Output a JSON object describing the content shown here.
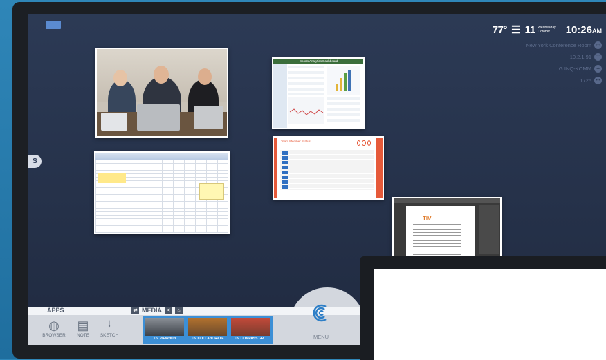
{
  "status": {
    "temperature": "77°",
    "weather_icon": "wind-icon",
    "day_number": "11",
    "weekday": "Wednesday",
    "month": "October",
    "time": "10:26",
    "ampm": "AM",
    "info": [
      {
        "text": "New York Conference Room",
        "icon": "monitor-icon",
        "glyph": "▭"
      },
      {
        "text": "10.2.1.91",
        "icon": "wifi-icon",
        "glyph": "⌔"
      },
      {
        "text": "G.INQ-KOMM",
        "icon": "network-icon",
        "glyph": "⏶"
      },
      {
        "text": "1725",
        "icon": "more-icon",
        "glyph": "•••"
      }
    ]
  },
  "windows": {
    "dashboard_title": "Sports Analytics Dashboard",
    "form_title": "Team Member Status"
  },
  "side_badge": "S",
  "dock": {
    "apps_title": "APPS",
    "media_title": "MEDIA",
    "apps": [
      {
        "label": "BROWSER",
        "icon": "globe-icon",
        "glyph": "🌐"
      },
      {
        "label": "NOTE",
        "icon": "note-icon",
        "glyph": "▤"
      },
      {
        "label": "SKETCH",
        "icon": "waveform-icon",
        "glyph": "⋀⋁"
      }
    ],
    "media": [
      {
        "label": "TIV VIEWHUB"
      },
      {
        "label": "TIV COLLABORATE"
      },
      {
        "label": "TIV COMPASS GR..."
      }
    ],
    "menu_label": "MENU"
  },
  "colors": {
    "accent": "#3c8fd6",
    "background": "#2c3a55",
    "dock": "#d3d7de"
  }
}
